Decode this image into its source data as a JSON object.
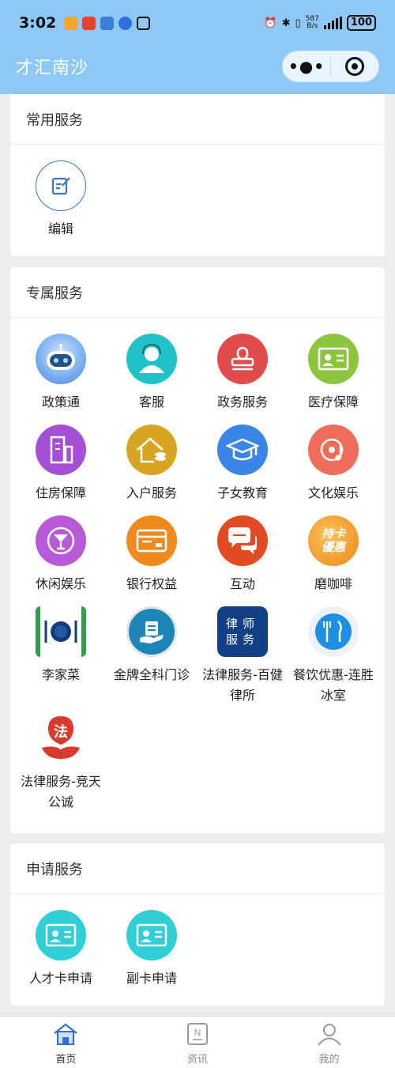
{
  "status": {
    "time": "3:02",
    "net_speed": "587",
    "net_unit": "B/s",
    "battery": "100"
  },
  "nav": {
    "title": "才汇南沙"
  },
  "sections": {
    "common": {
      "title": "常用服务",
      "items": [
        {
          "label": "编辑",
          "icon": "edit-icon"
        }
      ]
    },
    "exclusive": {
      "title": "专属服务",
      "items": [
        {
          "label": "政策通",
          "icon": "robot-icon"
        },
        {
          "label": "客服",
          "icon": "customer-service-icon"
        },
        {
          "label": "政务服务",
          "icon": "stamp-icon"
        },
        {
          "label": "医疗保障",
          "icon": "id-card-icon"
        },
        {
          "label": "住房保障",
          "icon": "building-icon"
        },
        {
          "label": "入户服务",
          "icon": "house-coins-icon"
        },
        {
          "label": "子女教育",
          "icon": "graduation-cap-icon"
        },
        {
          "label": "文化娱乐",
          "icon": "music-disc-icon"
        },
        {
          "label": "休闲娱乐",
          "icon": "cocktail-icon"
        },
        {
          "label": "银行权益",
          "icon": "bank-card-icon"
        },
        {
          "label": "互动",
          "icon": "chat-bubbles-icon"
        },
        {
          "label": "磨咖啡",
          "icon": "card-discount-icon",
          "icon_text": "持卡\n優惠"
        },
        {
          "label": "李家菜",
          "icon": "plate-cutlery-icon"
        },
        {
          "label": "金牌全科门诊",
          "icon": "medical-hand-icon"
        },
        {
          "label": "法律服务-百健律所",
          "icon": "lawyer-icon",
          "icon_text": "律师服务"
        },
        {
          "label": "餐饮优惠-连胜冰室",
          "icon": "fork-knife-icon"
        },
        {
          "label": "法律服务-竞天公诚",
          "icon": "law-hand-icon",
          "icon_text": "法"
        }
      ]
    },
    "apply": {
      "title": "申请服务",
      "items": [
        {
          "label": "人才卡申请",
          "icon": "talent-card-icon"
        },
        {
          "label": "副卡申请",
          "icon": "sub-card-icon"
        }
      ]
    }
  },
  "tabbar": [
    {
      "label": "首页",
      "icon": "home-icon",
      "active": true
    },
    {
      "label": "资讯",
      "icon": "news-icon",
      "active": false
    },
    {
      "label": "我的",
      "icon": "user-icon",
      "active": false
    }
  ]
}
